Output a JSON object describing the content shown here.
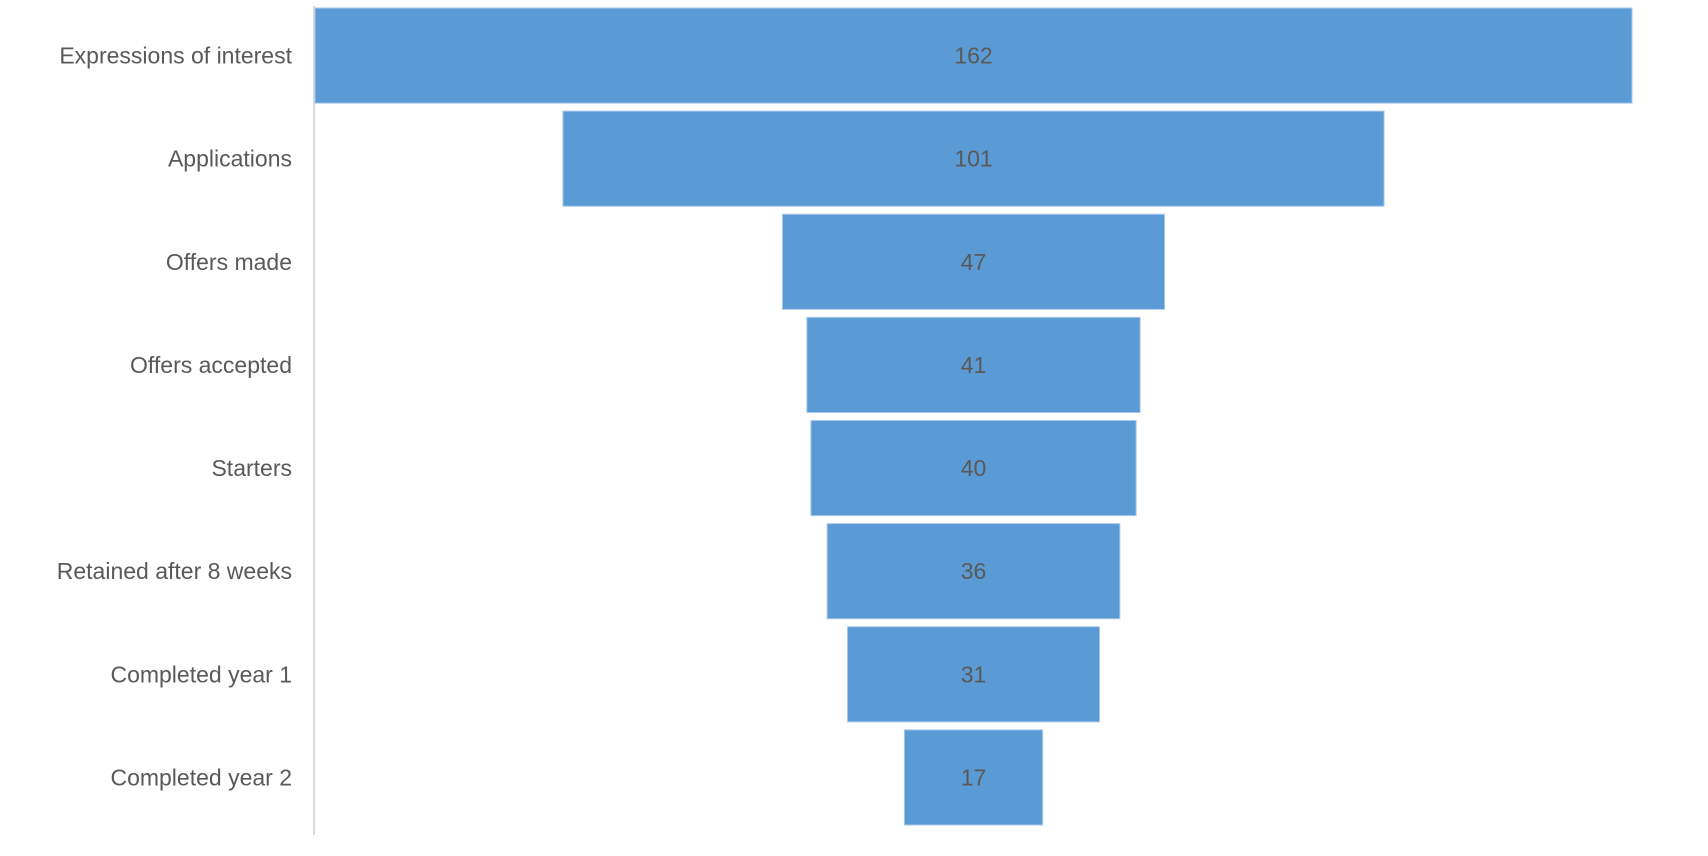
{
  "chart_data": {
    "type": "bar",
    "subtype": "funnel",
    "title": "",
    "xlabel": "",
    "ylabel": "",
    "categories": [
      "Expressions of interest",
      "Applications",
      "Offers made",
      "Offers accepted",
      "Starters",
      "Retained after 8 weeks",
      "Completed year 1",
      "Completed year 2"
    ],
    "values": [
      162,
      101,
      47,
      41,
      40,
      36,
      31,
      17
    ],
    "data_labels": [
      "162",
      "101",
      "47",
      "41",
      "40",
      "36",
      "31",
      "17"
    ],
    "grid": false,
    "legend": "none",
    "colors": {
      "bar": "#5B9BD5",
      "text": "#595959",
      "axis": "#d9d9d9"
    }
  }
}
